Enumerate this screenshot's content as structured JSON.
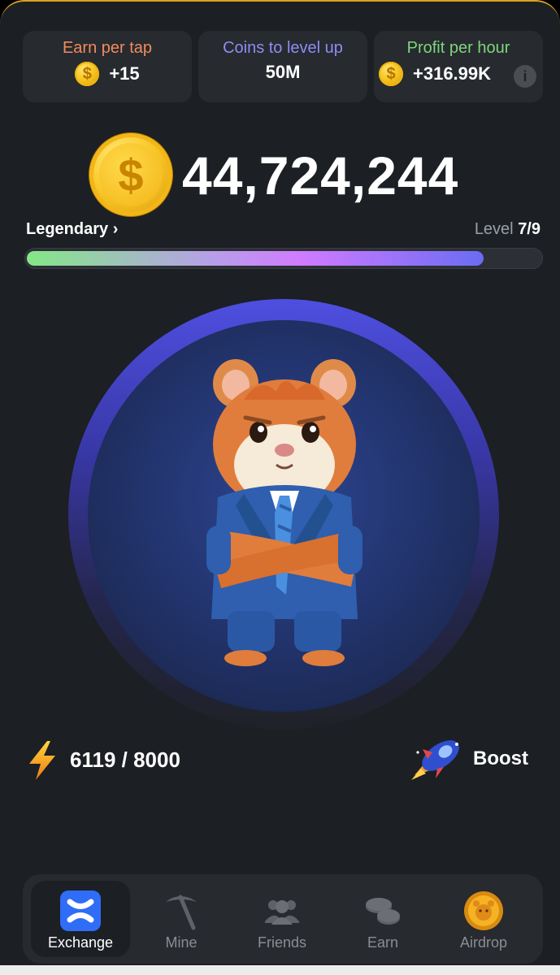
{
  "stats": {
    "earn_per_tap": {
      "label": "Earn per tap",
      "value": "+15",
      "color": "#f08c5c"
    },
    "coins_to_level_up": {
      "label": "Coins to level up",
      "value": "50M",
      "color": "#8f8cf3"
    },
    "profit_per_hour": {
      "label": "Profit per hour",
      "value": "+316.99K",
      "color": "#7ed67c"
    },
    "coin_symbol": "$",
    "info_symbol": "i"
  },
  "balance": {
    "coin_symbol": "$",
    "amount": "44,724,244"
  },
  "level": {
    "league": "Legendary",
    "chevron": "›",
    "prefix": "Level",
    "value": "7/9",
    "progress_percent": 89
  },
  "energy": {
    "text": "6119 / 8000",
    "current": 6119,
    "max": 8000
  },
  "boost": {
    "label": "Boost"
  },
  "nav": {
    "items": [
      {
        "label": "Exchange",
        "icon": "exchange-icon",
        "active": true
      },
      {
        "label": "Mine",
        "icon": "pickaxe-icon",
        "active": false
      },
      {
        "label": "Friends",
        "icon": "friends-icon",
        "active": false
      },
      {
        "label": "Earn",
        "icon": "coins-stack-icon",
        "active": false
      },
      {
        "label": "Airdrop",
        "icon": "hamster-coin-icon",
        "active": false
      }
    ]
  },
  "colors": {
    "background": "#1c1f24",
    "panel": "#272a2f",
    "accent_blue": "#4e4fe0",
    "gold": "#f9c82a",
    "frame_gold": "#d9a21f"
  }
}
